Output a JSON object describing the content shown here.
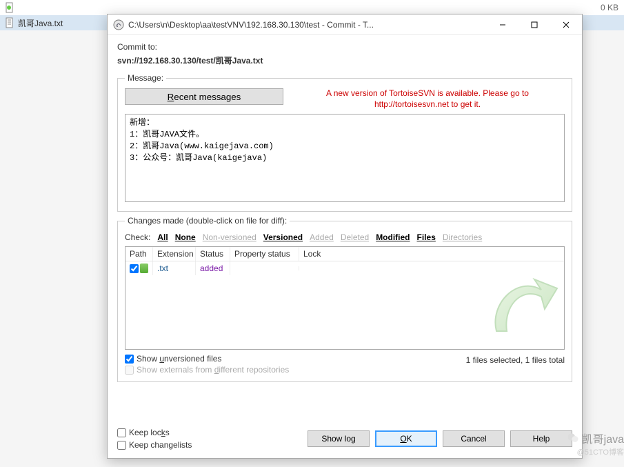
{
  "background": {
    "rows": [
      {
        "name": "",
        "date": "",
        "type": "",
        "size": "0 KB"
      }
    ],
    "selected_file": "凯哥Java.txt"
  },
  "dialog": {
    "title": "C:\\Users\\n\\Desktop\\aa\\testVNV\\192.168.30.130\\test - Commit - T...",
    "commit_to_label": "Commit to:",
    "commit_url": "svn://192.168.30.130/test/凯哥Java.txt",
    "message_legend": "Message:",
    "recent_messages": "Recent messages",
    "update_notice_l1": "A new version of TortoiseSVN is available. Please go to",
    "update_notice_l2": "http://tortoisesvn.net to get it.",
    "message_text": "新增：\n1：凯哥JAVA文件。\n2：凯哥Java(www.kaigejava.com)\n3：公众号：凯哥Java(kaigejava)",
    "changes_legend": "Changes made (double-click on file for diff):",
    "check_label": "Check:",
    "check_links": {
      "all": "All",
      "none": "None",
      "non_versioned": "Non-versioned",
      "versioned": "Versioned",
      "added": "Added",
      "deleted": "Deleted",
      "modified": "Modified",
      "files": "Files",
      "directories": "Directories"
    },
    "columns": {
      "path": "Path",
      "extension": "Extension",
      "status": "Status",
      "property_status": "Property status",
      "lock": "Lock"
    },
    "files": [
      {
        "checked": true,
        "extension": ".txt",
        "status": "added"
      }
    ],
    "show_unversioned": "Show unversioned files",
    "show_externals": "Show externals from different repositories",
    "stats": "1 files selected, 1 files total",
    "keep_locks": "Keep locks",
    "keep_changelists": "Keep changelists",
    "buttons": {
      "show_log": "Show log",
      "ok": "OK",
      "cancel": "Cancel",
      "help": "Help"
    }
  },
  "watermark": {
    "line1": "凯哥java",
    "line2": "@51CTO博客"
  }
}
